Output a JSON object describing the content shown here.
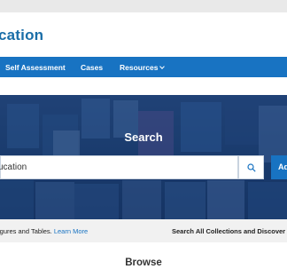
{
  "header": {
    "logo_text": "cation"
  },
  "nav": {
    "items": [
      {
        "label": "Self Assessment"
      },
      {
        "label": "Cases"
      },
      {
        "label": "Resources"
      }
    ]
  },
  "hero": {
    "title": "Search",
    "search": {
      "value": "ucation",
      "button_label": "Ad"
    }
  },
  "info_bar": {
    "left_text": "igures and Tables.",
    "left_link": "Learn More",
    "right_text": "Search All Collections and Discover I"
  },
  "browse": {
    "title": "Browse"
  },
  "icons": {
    "search": "search-icon",
    "chevron": "chevron-down-icon"
  },
  "colors": {
    "brand": "#1873c2",
    "logo": "#1a6ea8"
  }
}
